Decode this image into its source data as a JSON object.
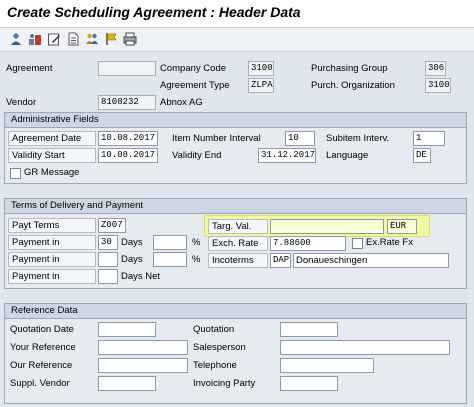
{
  "window": {
    "title": "Create Scheduling Agreement : Header Data"
  },
  "toolbar": {
    "icons": [
      "person-icon",
      "org-icon",
      "edit-icon",
      "document-icon",
      "partners-icon",
      "flag-icon",
      "print-icon"
    ]
  },
  "header": {
    "agreement_label": "Agreement",
    "agreement_value": "",
    "company_code_label": "Company Code",
    "company_code_value": "3100",
    "purchasing_group_label": "Purchasing Group",
    "purchasing_group_value": "306",
    "agreement_type_label": "Agreement Type",
    "agreement_type_value": "ZLPA",
    "purch_org_label": "Purch. Organization",
    "purch_org_value": "3100",
    "vendor_label": "Vendor",
    "vendor_value": "8108232",
    "vendor_name": "Abnox AG"
  },
  "admin": {
    "title": "Administrative Fields",
    "agreement_date_label": "Agreement Date",
    "agreement_date_value": "10.08.2017",
    "item_interval_label": "Item Number Interval",
    "item_interval_value": "10",
    "subitem_interval_label": "Subitem Interv.",
    "subitem_interval_value": "1",
    "validity_start_label": "Validity Start",
    "validity_start_value": "10.08.2017",
    "validity_end_label": "Validity End",
    "validity_end_value": "31.12.2017",
    "language_label": "Language",
    "language_value": "DE",
    "gr_message_label": "GR Message"
  },
  "terms": {
    "title": "Terms of Delivery and Payment",
    "payt_terms_label": "Payt Terms",
    "payt_terms_value": "Z007",
    "payment_in_label": "Payment in",
    "payment1_days": "30",
    "days_label": "Days",
    "percent": "%",
    "days_net_label": "Days Net",
    "targ_val_label": "Targ. Val.",
    "targ_val_value": "",
    "currency_value": "EUR",
    "exch_rate_label": "Exch. Rate",
    "exch_rate_value": "7.88600",
    "exrate_fx_label": "Ex.Rate Fx",
    "incoterms_label": "Incoterms",
    "incoterms_code": "DAP",
    "incoterms_place": "Donaueschingen"
  },
  "reference": {
    "title": "Reference Data",
    "quotation_date_label": "Quotation Date",
    "quotation_label": "Quotation",
    "your_reference_label": "Your Reference",
    "salesperson_label": "Salesperson",
    "our_reference_label": "Our Reference",
    "telephone_label": "Telephone",
    "suppl_vendor_label": "Suppl. Vendor",
    "invoicing_party_label": "Invoicing Party"
  },
  "colors": {
    "highlight": "#f2f7a3",
    "group_header": "#cdd7e4",
    "background": "#dfe6ee"
  }
}
